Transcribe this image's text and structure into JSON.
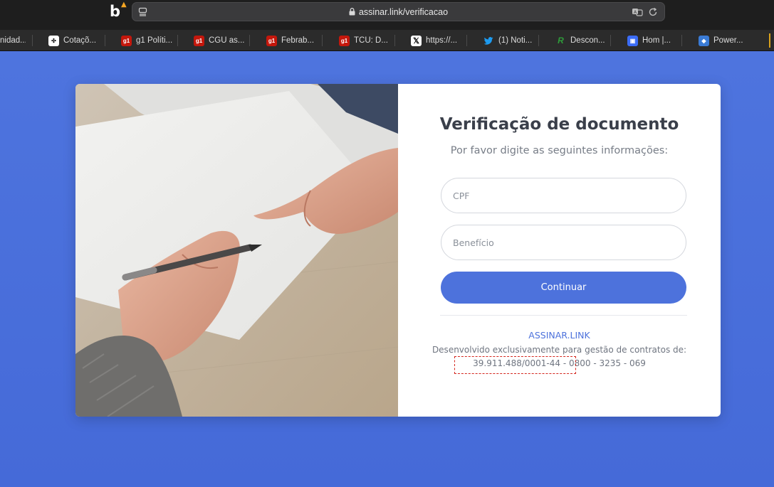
{
  "browser": {
    "url": "assinar.link/verificacao",
    "bookmarks": [
      {
        "label": "nidad...",
        "icon": "none"
      },
      {
        "label": "Cotaçõ...",
        "icon": "grid-icon",
        "color": "#ffffff"
      },
      {
        "label": "g1 Políti...",
        "icon": "g1-icon",
        "color": "#c4170c"
      },
      {
        "label": "CGU as...",
        "icon": "g1-icon",
        "color": "#c4170c"
      },
      {
        "label": "Febrab...",
        "icon": "g1-icon",
        "color": "#c4170c"
      },
      {
        "label": "TCU: D...",
        "icon": "g1-icon",
        "color": "#c4170c"
      },
      {
        "label": "https://...",
        "icon": "x-icon",
        "color": "#000000"
      },
      {
        "label": "(1) Noti...",
        "icon": "twitter-icon",
        "color": "#1d9bf0"
      },
      {
        "label": "Descon...",
        "icon": "r-icon",
        "color": "#2e9b3a"
      },
      {
        "label": "Hom |...",
        "icon": "app-icon",
        "color": "#3b6cf6"
      },
      {
        "label": "Power...",
        "icon": "power-icon",
        "color": "#3a7bd5"
      }
    ]
  },
  "page": {
    "title": "Verificação de documento",
    "subtitle": "Por favor digite as seguintes informações:",
    "cpf_placeholder": "CPF",
    "beneficio_placeholder": "Benefício",
    "continue_label": "Continuar",
    "brand_link": "ASSINAR.LINK",
    "developed_text": "Desenvolvido exclusivamente para gestão de contratos de:",
    "contact_line": "39.911.488/0001-44 - 0800 - 3235 - 069"
  },
  "colors": {
    "primary": "#4d72dc",
    "background": "#4e74de",
    "highlight": "#d4271e"
  }
}
